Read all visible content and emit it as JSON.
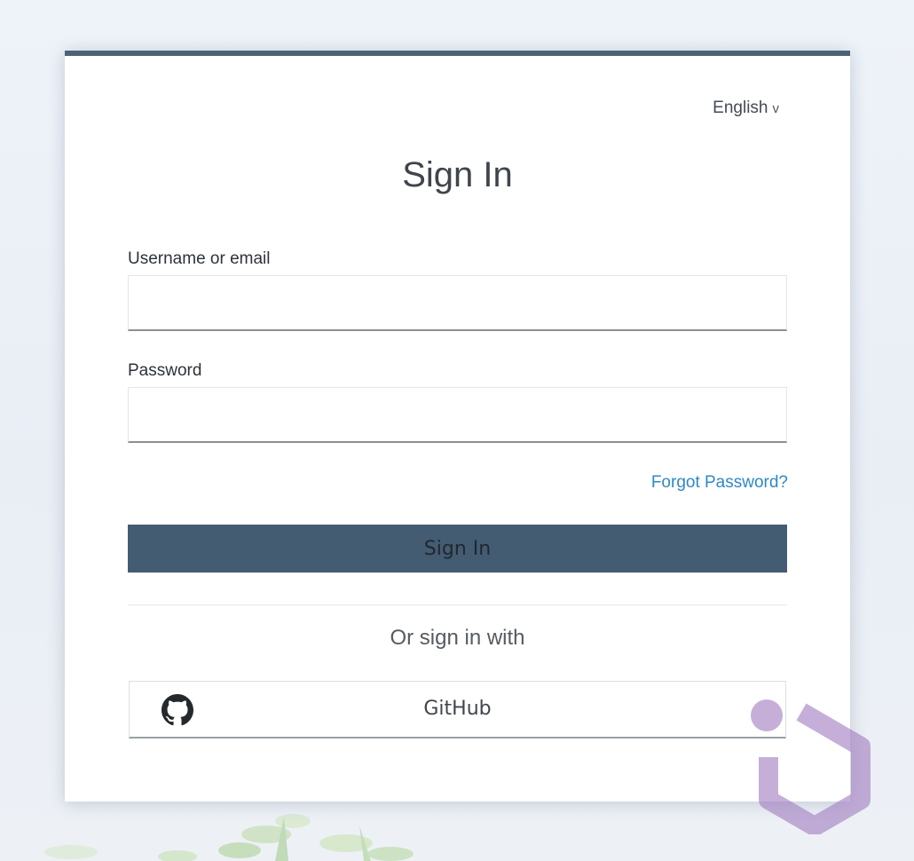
{
  "header": {
    "language": "English",
    "language_caret": "v"
  },
  "form": {
    "title": "Sign In",
    "username_label": "Username or email",
    "username_value": "",
    "password_label": "Password",
    "password_value": "",
    "forgot_password": "Forgot Password?",
    "submit_label": "Sign In"
  },
  "social": {
    "divider_text": "Or sign in with",
    "providers": [
      {
        "label": "GitHub",
        "icon": "github-icon"
      }
    ]
  },
  "colors": {
    "accent": "#4a6378",
    "button": "#445c72",
    "link": "#2f88c6",
    "watermark": "#a37fc2"
  }
}
